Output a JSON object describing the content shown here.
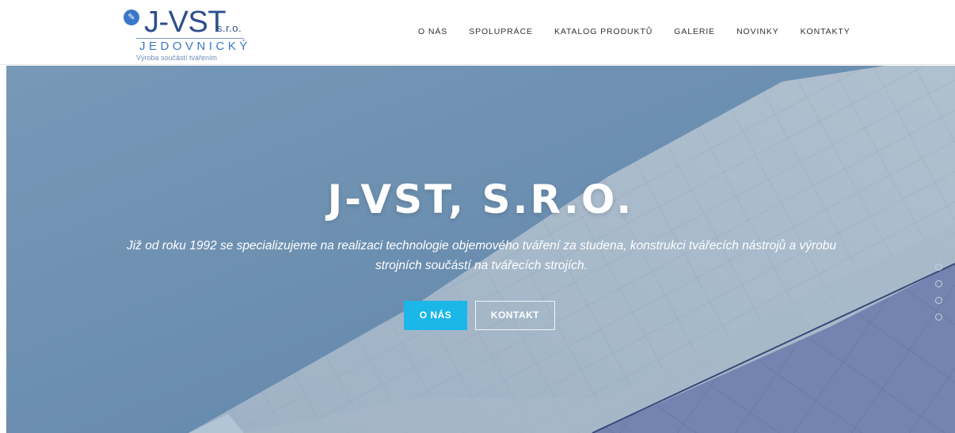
{
  "header": {
    "logo": {
      "name": "J-VST",
      "suffix": "s.r.o.",
      "subtitle": "JEDOVNICKÝ",
      "tagline": "Výroba součástí tvářením",
      "icon": "pencil-icon"
    },
    "nav": [
      {
        "label": "O NÁS"
      },
      {
        "label": "SPOLUPRÁCE"
      },
      {
        "label": "KATALOG PRODUKTŮ"
      },
      {
        "label": "GALERIE"
      },
      {
        "label": "NOVINKY"
      },
      {
        "label": "KONTAKTY"
      }
    ]
  },
  "hero": {
    "title": "J-VST, S.R.O.",
    "text": "Již od roku 1992 se specializujeme na realizaci technologie objemového tváření za studena, konstrukci tvářecích nástrojů a výrobu strojních součástí na tvářecích strojích.",
    "primary_button": "O NÁS",
    "secondary_button": "KONTAKT",
    "slides": 4,
    "active_slide": 1
  },
  "colors": {
    "accent": "#1bb7e8",
    "brand": "#2d4f8a",
    "sky": "#6f93b5"
  }
}
